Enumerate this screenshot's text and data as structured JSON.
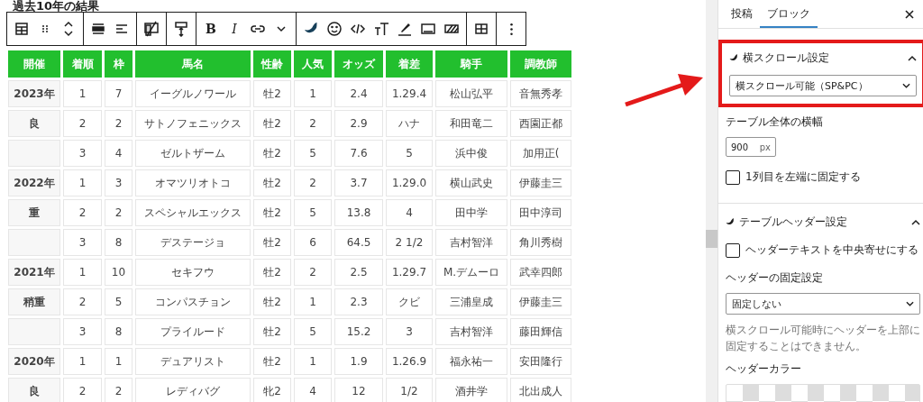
{
  "heading": "過去10年の結果",
  "toolbar": [
    [
      {
        "kind": "table"
      },
      {
        "kind": "drag"
      },
      {
        "kind": "updown"
      }
    ],
    [
      {
        "kind": "align-full"
      },
      {
        "kind": "align-left"
      }
    ],
    [
      {
        "kind": "device"
      }
    ],
    [
      {
        "kind": "height"
      }
    ],
    [
      {
        "kind": "text",
        "label": "B"
      },
      {
        "kind": "italic",
        "label": "I"
      },
      {
        "kind": "link"
      },
      {
        "kind": "caret"
      }
    ],
    [
      {
        "kind": "logo"
      },
      {
        "kind": "smile"
      },
      {
        "kind": "code"
      },
      {
        "kind": "fontsize"
      },
      {
        "kind": "highlight"
      },
      {
        "kind": "frame"
      },
      {
        "kind": "hatch"
      }
    ],
    [
      {
        "kind": "grid"
      }
    ],
    [
      {
        "kind": "more"
      }
    ]
  ],
  "table": {
    "columns": [
      "開催",
      "着順",
      "枠",
      "馬名",
      "性齢",
      "人気",
      "オッズ",
      "着差",
      "騎手",
      "調教師"
    ],
    "rows": [
      [
        "2023年",
        "1",
        "7",
        "イーグルノワール",
        "牡2",
        "1",
        "2.4",
        "1.29.4",
        "松山弘平",
        "音無秀孝"
      ],
      [
        "良",
        "2",
        "2",
        "サトノフェニックス",
        "牡2",
        "2",
        "2.9",
        "ハナ",
        "和田竜二",
        "西園正都"
      ],
      [
        "",
        "3",
        "4",
        "ゼルトザーム",
        "牡2",
        "5",
        "7.6",
        "5",
        "浜中俊",
        "加用正("
      ],
      [
        "2022年",
        "1",
        "3",
        "オマツリオトコ",
        "牡2",
        "2",
        "3.7",
        "1.29.0",
        "横山武史",
        "伊藤圭三"
      ],
      [
        "重",
        "2",
        "2",
        "スペシャルエックス",
        "牡2",
        "5",
        "13.8",
        "4",
        "田中学",
        "田中淳司"
      ],
      [
        "",
        "3",
        "8",
        "デステージョ",
        "牡2",
        "6",
        "64.5",
        "2 1/2",
        "吉村智洋",
        "角川秀樹"
      ],
      [
        "2021年",
        "1",
        "10",
        "セキフウ",
        "牡2",
        "2",
        "2.5",
        "1.29.7",
        "M.デムーロ",
        "武幸四郎"
      ],
      [
        "稍重",
        "2",
        "5",
        "コンパスチョン",
        "牡2",
        "1",
        "2.3",
        "クビ",
        "三浦皇成",
        "伊藤圭三"
      ],
      [
        "",
        "3",
        "8",
        "プライルード",
        "牡2",
        "5",
        "15.2",
        "3",
        "吉村智洋",
        "藤田輝信"
      ],
      [
        "2020年",
        "1",
        "1",
        "デュアリスト",
        "牡2",
        "1",
        "1.9",
        "1.26.9",
        "福永祐一",
        "安田隆行"
      ],
      [
        "良",
        "2",
        "2",
        "レディバグ",
        "牝2",
        "4",
        "12",
        "1/2",
        "酒井学",
        "北出成人"
      ]
    ]
  },
  "sidebar": {
    "tabs": [
      {
        "label": "投稿",
        "selected": false
      },
      {
        "label": "ブロック",
        "selected": true
      }
    ],
    "scroll_panel": {
      "title": "横スクロール設定",
      "expanded": true,
      "highlighted": true,
      "select": "横スクロール可能（SP&PC）",
      "width_label": "テーブル全体の横幅",
      "width_value": "900",
      "width_unit": "px",
      "checkbox": {
        "label": "1列目を左端に固定する",
        "checked": false
      }
    },
    "header_panel": {
      "title": "テーブルヘッダー設定",
      "expanded": true,
      "checkbox": {
        "label": "ヘッダーテキストを中央寄せにする",
        "checked": false
      },
      "fix_label": "ヘッダーの固定設定",
      "fix_select": "固定しない",
      "help": "横スクロール可能時にヘッダーを上部に固定することはできません。",
      "color_label": "ヘッダーカラー"
    }
  }
}
